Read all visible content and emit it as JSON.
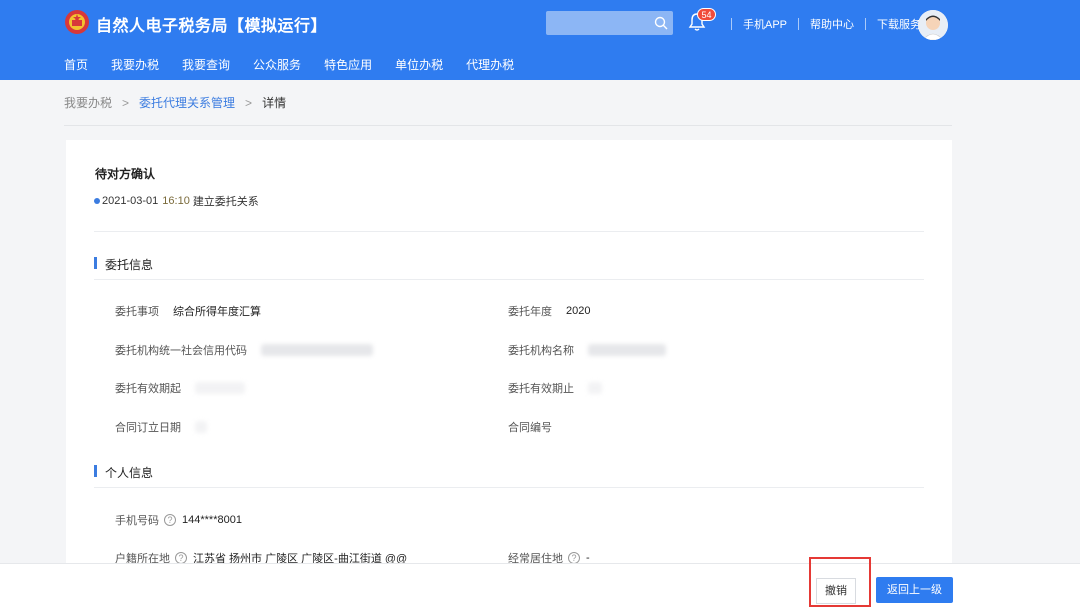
{
  "header": {
    "app_title": "自然人电子税务局【模拟运行】",
    "search_placeholder": "",
    "notification_count": "54",
    "links": [
      "手机APP",
      "帮助中心",
      "下载服务"
    ],
    "nav": [
      "首页",
      "我要办税",
      "我要查询",
      "公众服务",
      "特色应用",
      "单位办税",
      "代理办税"
    ]
  },
  "breadcrumb": {
    "items": [
      "我要办税",
      "委托代理关系管理",
      "详情"
    ]
  },
  "status": {
    "title": "待对方确认",
    "date": "2021-03-01",
    "time": "16:10",
    "event": "建立委托关系"
  },
  "delegation": {
    "section_title": "委托信息",
    "fields": [
      {
        "label": "委托事项",
        "value": "综合所得年度汇算"
      },
      {
        "label": "委托年度",
        "value": "2020"
      },
      {
        "label": "委托机构统一社会信用代码",
        "value": ""
      },
      {
        "label": "委托机构名称",
        "value": ""
      },
      {
        "label": "委托有效期起",
        "value": ""
      },
      {
        "label": "委托有效期止",
        "value": ""
      },
      {
        "label": "合同订立日期",
        "value": ""
      },
      {
        "label": "合同编号",
        "value": ""
      }
    ]
  },
  "personal": {
    "section_title": "个人信息",
    "phone_label": "手机号码",
    "phone_value": "144****8001",
    "household_label": "户籍所在地",
    "household_value": "江苏省 扬州市 广陵区 广陵区-曲江街道 @@",
    "residence_label": "经常居住地",
    "residence_value": "-"
  },
  "footer": {
    "cancel_label": "撤销",
    "back_label": "返回上一级"
  },
  "colors": {
    "brand_blue": "#2f7cf0",
    "highlight_red": "#e53935"
  }
}
